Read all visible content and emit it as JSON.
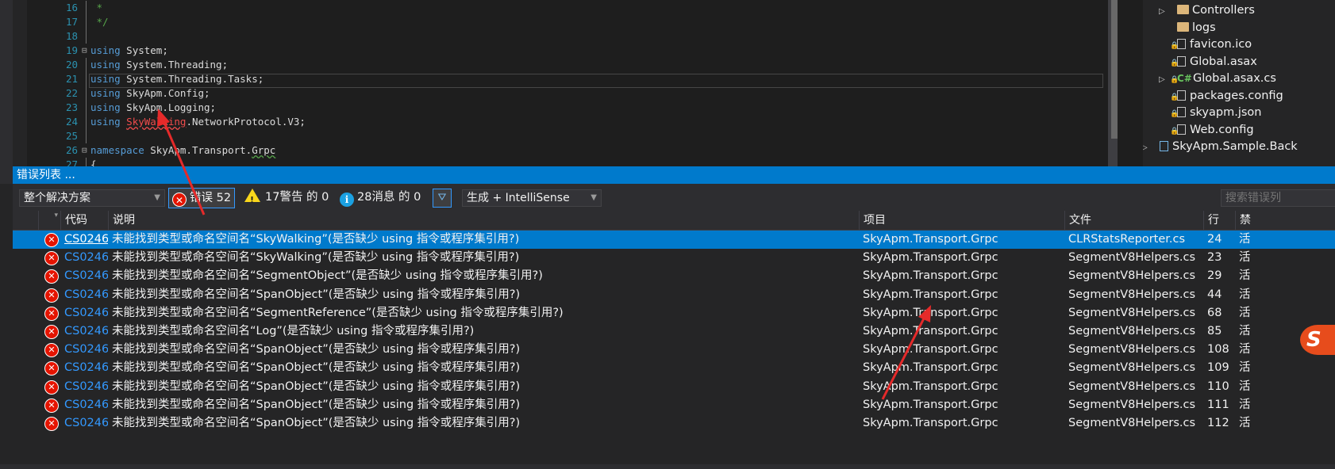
{
  "editor": {
    "lines": [
      {
        "n": "16",
        "fold": "",
        "parts": [
          {
            "c": "cm",
            "t": " *"
          }
        ]
      },
      {
        "n": "17",
        "fold": "",
        "parts": [
          {
            "c": "cm",
            "t": " */"
          }
        ]
      },
      {
        "n": "18",
        "fold": "",
        "parts": []
      },
      {
        "n": "19",
        "fold": "⊟",
        "parts": [
          {
            "c": "kw",
            "t": "using"
          },
          {
            "c": "",
            "t": " System;"
          }
        ]
      },
      {
        "n": "20",
        "fold": "",
        "parts": [
          {
            "c": "kw",
            "t": "using"
          },
          {
            "c": "",
            "t": " System.Threading;"
          }
        ]
      },
      {
        "n": "21",
        "fold": "",
        "parts": [
          {
            "c": "kw",
            "t": "using"
          },
          {
            "c": "",
            "t": " System.Threading.Tasks;"
          }
        ]
      },
      {
        "n": "22",
        "fold": "",
        "parts": [
          {
            "c": "kw",
            "t": "using"
          },
          {
            "c": "",
            "t": " SkyApm.Config;"
          }
        ]
      },
      {
        "n": "23",
        "fold": "",
        "parts": [
          {
            "c": "kw",
            "t": "using"
          },
          {
            "c": "",
            "t": " SkyApm.Logging;"
          }
        ]
      },
      {
        "n": "24",
        "fold": "",
        "parts": [
          {
            "c": "kw",
            "t": "using"
          },
          {
            "c": "",
            "t": " "
          },
          {
            "c": "err",
            "t": "SkyWalking"
          },
          {
            "c": "",
            "t": ".NetworkProtocol.V3;"
          }
        ]
      },
      {
        "n": "25",
        "fold": "",
        "parts": []
      },
      {
        "n": "26",
        "fold": "⊟",
        "parts": [
          {
            "c": "kw",
            "t": "namespace"
          },
          {
            "c": "",
            "t": " SkyApm.Transport."
          },
          {
            "c": "warn",
            "t": "Grpc"
          }
        ]
      },
      {
        "n": "27",
        "fold": "",
        "parts": [
          {
            "c": "",
            "t": "{"
          }
        ]
      }
    ]
  },
  "solution_explorer": {
    "items": [
      {
        "name": "Controllers",
        "kind": "folder",
        "arrow": "▷",
        "indent": 1
      },
      {
        "name": "logs",
        "kind": "folder",
        "arrow": "",
        "indent": 1
      },
      {
        "name": "favicon.ico",
        "kind": "file",
        "arrow": "",
        "indent": 1
      },
      {
        "name": "Global.asax",
        "kind": "file",
        "arrow": "",
        "indent": 1
      },
      {
        "name": "Global.asax.cs",
        "kind": "cs",
        "arrow": "▷",
        "indent": 1
      },
      {
        "name": "packages.config",
        "kind": "file",
        "arrow": "",
        "indent": 1
      },
      {
        "name": "skyapm.json",
        "kind": "file",
        "arrow": "",
        "indent": 1
      },
      {
        "name": "Web.config",
        "kind": "file",
        "arrow": "",
        "indent": 1
      },
      {
        "name": "SkyApm.Sample.Back",
        "kind": "project",
        "arrow": "▷",
        "indent": 0
      }
    ]
  },
  "error_list": {
    "title": "错误列表 ...",
    "scope": "整个解决方案",
    "errors_label": "错误 52",
    "warnings_label": "17警告 的 0",
    "messages_label": "28消息 的 0",
    "build_filter": "生成 + IntelliSense",
    "search_placeholder": "搜索错误列",
    "columns": {
      "code": "代码",
      "desc": "说明",
      "project": "项目",
      "file": "文件",
      "line": "行",
      "suppress": "禁"
    },
    "rows": [
      {
        "code": "CS0246",
        "desc": "未能找到类型或命名空间名“SkyWalking”(是否缺少 using 指令或程序集引用?)",
        "project": "SkyApm.Transport.Grpc",
        "file": "CLRStatsReporter.cs",
        "line": "24",
        "tail": "活"
      },
      {
        "code": "CS0246",
        "desc": "未能找到类型或命名空间名“SkyWalking”(是否缺少 using 指令或程序集引用?)",
        "project": "SkyApm.Transport.Grpc",
        "file": "SegmentV8Helpers.cs",
        "line": "23",
        "tail": "活"
      },
      {
        "code": "CS0246",
        "desc": "未能找到类型或命名空间名“SegmentObject”(是否缺少 using 指令或程序集引用?)",
        "project": "SkyApm.Transport.Grpc",
        "file": "SegmentV8Helpers.cs",
        "line": "29",
        "tail": "活"
      },
      {
        "code": "CS0246",
        "desc": "未能找到类型或命名空间名“SpanObject”(是否缺少 using 指令或程序集引用?)",
        "project": "SkyApm.Transport.Grpc",
        "file": "SegmentV8Helpers.cs",
        "line": "44",
        "tail": "活"
      },
      {
        "code": "CS0246",
        "desc": "未能找到类型或命名空间名“SegmentReference”(是否缺少 using 指令或程序集引用?)",
        "project": "SkyApm.Transport.Grpc",
        "file": "SegmentV8Helpers.cs",
        "line": "68",
        "tail": "活"
      },
      {
        "code": "CS0246",
        "desc": "未能找到类型或命名空间名“Log”(是否缺少 using 指令或程序集引用?)",
        "project": "SkyApm.Transport.Grpc",
        "file": "SegmentV8Helpers.cs",
        "line": "85",
        "tail": "活"
      },
      {
        "code": "CS0246",
        "desc": "未能找到类型或命名空间名“SpanObject”(是否缺少 using 指令或程序集引用?)",
        "project": "SkyApm.Transport.Grpc",
        "file": "SegmentV8Helpers.cs",
        "line": "108",
        "tail": "活"
      },
      {
        "code": "CS0246",
        "desc": "未能找到类型或命名空间名“SpanObject”(是否缺少 using 指令或程序集引用?)",
        "project": "SkyApm.Transport.Grpc",
        "file": "SegmentV8Helpers.cs",
        "line": "109",
        "tail": "活"
      },
      {
        "code": "CS0246",
        "desc": "未能找到类型或命名空间名“SpanObject”(是否缺少 using 指令或程序集引用?)",
        "project": "SkyApm.Transport.Grpc",
        "file": "SegmentV8Helpers.cs",
        "line": "110",
        "tail": "活"
      },
      {
        "code": "CS0246",
        "desc": "未能找到类型或命名空间名“SpanObject”(是否缺少 using 指令或程序集引用?)",
        "project": "SkyApm.Transport.Grpc",
        "file": "SegmentV8Helpers.cs",
        "line": "111",
        "tail": "活"
      },
      {
        "code": "CS0246",
        "desc": "未能找到类型或命名空间名“SpanObject”(是否缺少 using 指令或程序集引用?)",
        "project": "SkyApm.Transport.Grpc",
        "file": "SegmentV8Helpers.cs",
        "line": "112",
        "tail": "活"
      }
    ]
  },
  "colors": {
    "selection": "#007acc",
    "error": "#e51400",
    "accent": "#3399ff",
    "arrow": "#e52a2a"
  }
}
